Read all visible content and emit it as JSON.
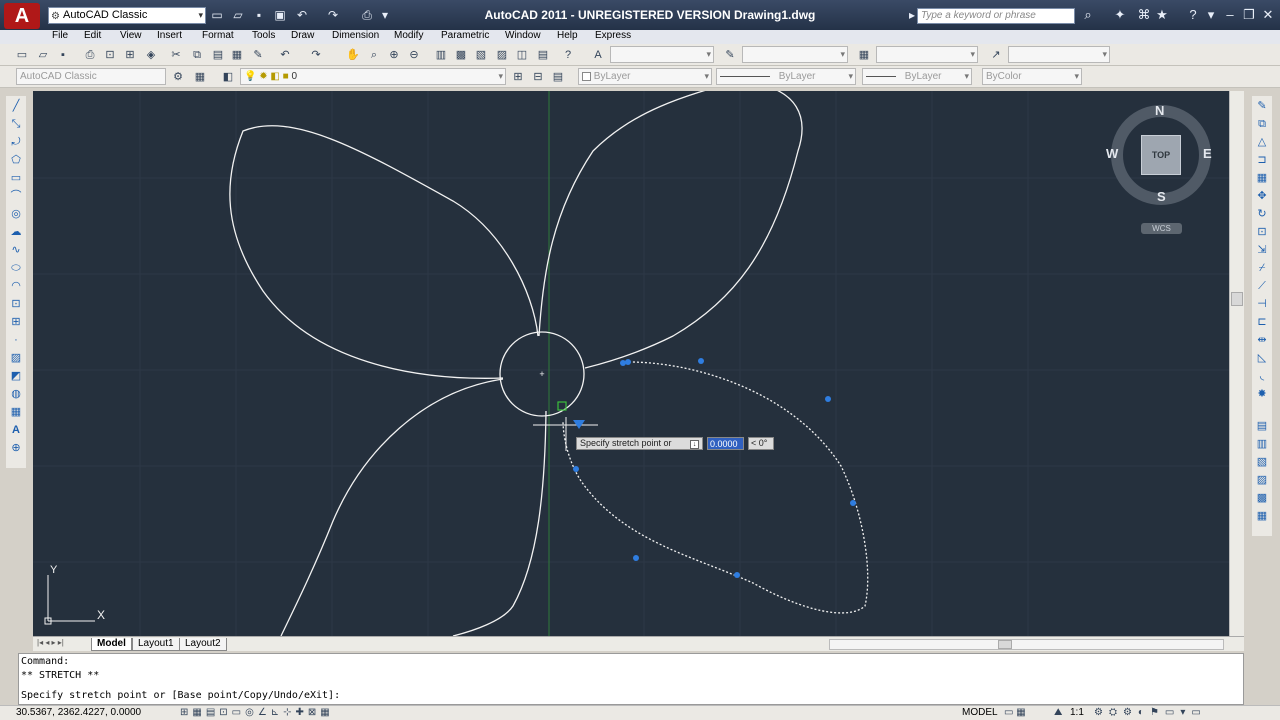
{
  "titlebar": {
    "workspace": "AutoCAD Classic",
    "title": "AutoCAD 2011 - UNREGISTERED VERSION    Drawing1.dwg",
    "search_placeholder": "Type a keyword or phrase"
  },
  "menu": [
    "File",
    "Edit",
    "View",
    "Insert",
    "Format",
    "Tools",
    "Draw",
    "Dimension",
    "Modify",
    "Parametric",
    "Window",
    "Help",
    "Express"
  ],
  "toolbar2": {
    "workspace_combo": "AutoCAD Classic",
    "layer_combo": "0",
    "color_combo": "ByLayer",
    "linetype_combo": "ByLayer",
    "lineweight_combo": "ByLayer",
    "plotstyle_combo": "ByColor"
  },
  "viewcube": {
    "north": "N",
    "south": "S",
    "east": "E",
    "west": "W",
    "face": "TOP",
    "ucs_label": "WCS"
  },
  "ucs_icon": {
    "y": "Y",
    "x": "X"
  },
  "dynamic_input": {
    "prompt": "Specify stretch point or",
    "value": "0.0000",
    "angle": "< 0°"
  },
  "layout_tabs": [
    "Model",
    "Layout1",
    "Layout2"
  ],
  "command_line": {
    "line1": "Command:",
    "line2": "** STRETCH **",
    "line3": "Specify stretch point or [Base point/Copy/Undo/eXit]:"
  },
  "status": {
    "coordinates": "30.5367, 2362.4227, 0.0000",
    "model": "MODEL",
    "scale": "1:1"
  },
  "colors": {
    "canvas": "#25303d",
    "grip": "#2f7de0",
    "curve": "#f2f2f2"
  }
}
